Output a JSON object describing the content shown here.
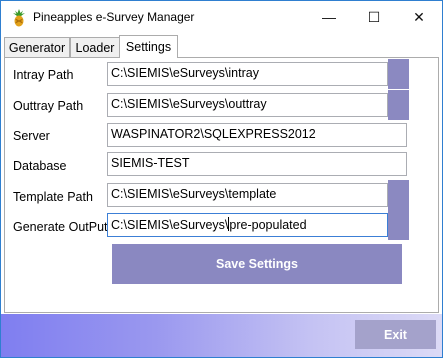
{
  "window": {
    "title": "Pineapples e-Survey Manager",
    "controls": {
      "minimize": "—",
      "maximize": "☐",
      "close": "✕"
    }
  },
  "tabs": [
    {
      "label": "Generator",
      "active": false
    },
    {
      "label": "Loader",
      "active": false
    },
    {
      "label": "Settings",
      "active": true
    }
  ],
  "settings": {
    "intray": {
      "label": "Intray Path",
      "value": "C:\\SIEMIS\\eSurveys\\intray"
    },
    "outtray": {
      "label": "Outtray Path",
      "value": "C:\\SIEMIS\\eSurveys\\outtray"
    },
    "server": {
      "label": "Server",
      "value": "WASPINATOR2\\SQLEXPRESS2012"
    },
    "database": {
      "label": "Database",
      "value": "SIEMIS-TEST"
    },
    "template": {
      "label": "Template Path",
      "value": "C:\\SIEMIS\\eSurveys\\template"
    },
    "generate": {
      "label": "Generate OutPut",
      "value_before_caret": "C:\\SIEMIS\\eSurveys\\",
      "value_after_caret": "pre-populated"
    }
  },
  "buttons": {
    "save": "Save Settings",
    "exit": "Exit"
  },
  "colors": {
    "accent": "#8b89c1",
    "footer_start": "#7f7ef0",
    "footer_end": "#dcdaf6"
  }
}
